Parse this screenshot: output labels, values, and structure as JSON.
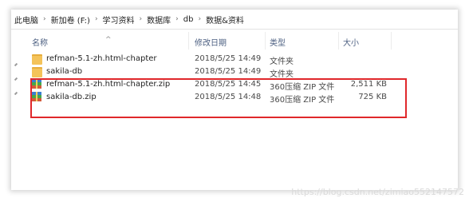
{
  "breadcrumb": [
    "此电脑",
    "新加卷 (F:)",
    "学习资料",
    "数据库",
    "db",
    "数据&资料"
  ],
  "columns": {
    "name": "名称",
    "date": "修改日期",
    "type": "类型",
    "size": "大小"
  },
  "files": [
    {
      "icon": "folder-icon",
      "name": "refman-5.1-zh.html-chapter",
      "date": "2018/5/25 14:49",
      "type": "文件夹",
      "size": ""
    },
    {
      "icon": "folder-icon",
      "name": "sakila-db",
      "date": "2018/5/25 14:49",
      "type": "文件夹",
      "size": ""
    },
    {
      "icon": "zip-icon",
      "name": "refman-5.1-zh.html-chapter.zip",
      "date": "2018/5/25 14:45",
      "type": "360压缩 ZIP 文件",
      "size": "2,511 KB"
    },
    {
      "icon": "zip-icon",
      "name": "sakila-db.zip",
      "date": "2018/5/25 14:48",
      "type": "360压缩 ZIP 文件",
      "size": "725 KB"
    }
  ],
  "highlight_color": "#e0282b",
  "watermark": "https://blog.csdn.net/zimiao552147572"
}
